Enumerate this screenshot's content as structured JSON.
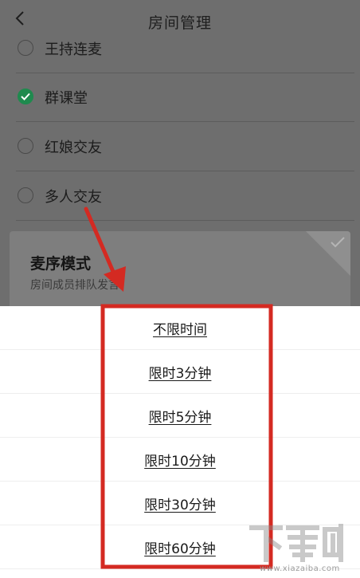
{
  "header": {
    "title": "房间管理",
    "back_icon": "chevron-left-icon"
  },
  "options": [
    {
      "label": "王持连麦",
      "checked": false
    },
    {
      "label": "群课堂",
      "checked": true
    },
    {
      "label": "红娘交友",
      "checked": false
    },
    {
      "label": "多人交友",
      "checked": false
    }
  ],
  "mode_card": {
    "title": "麦序模式",
    "description": "房间成员排队发言"
  },
  "time_limit_sheet": {
    "items": [
      "不限时间",
      "限时3分钟",
      "限时5分钟",
      "限时10分钟",
      "限时30分钟",
      "限时60分钟"
    ]
  },
  "annotation": {
    "color": "#d42a22"
  },
  "watermark": {
    "logo_text": "下载吧",
    "url": "www.xiazaiba.com"
  },
  "colors": {
    "overlay": "#6e6e6e",
    "checked": "#1f8a4e",
    "highlight": "#d42a22"
  }
}
